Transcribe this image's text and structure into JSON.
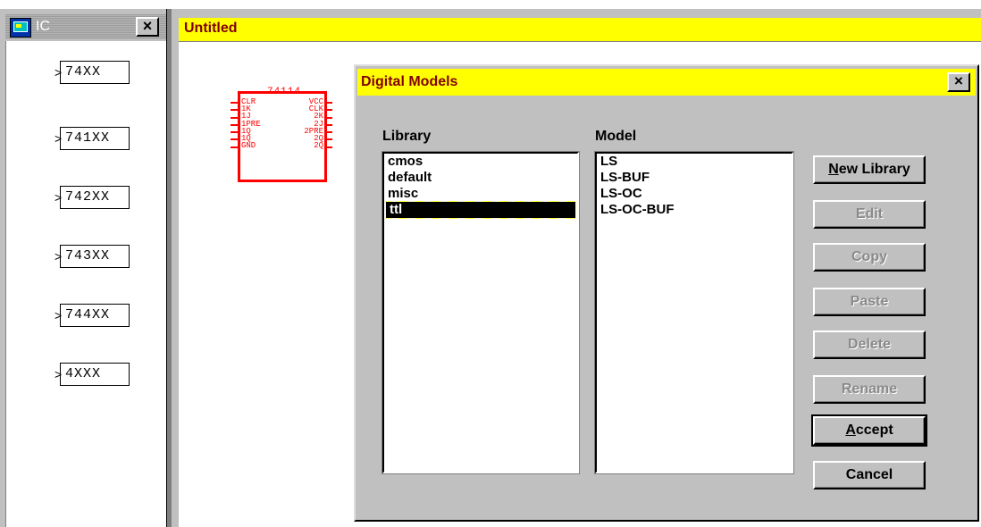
{
  "palette": {
    "title": "IC",
    "close_glyph": "×",
    "items": [
      "74XX",
      "741XX",
      "742XX",
      "743XX",
      "744XX",
      "4XXX"
    ]
  },
  "main": {
    "title": "Untitled"
  },
  "chip": {
    "name": "74114",
    "left_pins": [
      "CLR",
      "1K",
      "1J",
      "1PRE",
      "1Q",
      "1Q",
      "GND"
    ],
    "right_pins": [
      "VCC",
      "CLK",
      "2K",
      "2J",
      "2PRE",
      "2Q",
      "2Q"
    ]
  },
  "dialog": {
    "title": "Digital Models",
    "close_glyph": "×",
    "library_label": "Library",
    "model_label": "Model",
    "libraries": [
      "cmos",
      "default",
      "misc",
      "ttl"
    ],
    "selected_library": "ttl",
    "models": [
      "LS",
      "LS-BUF",
      "LS-OC",
      "LS-OC-BUF"
    ],
    "buttons": {
      "new_library": {
        "mnemonic": "N",
        "rest": "ew Library"
      },
      "edit": "Edit",
      "copy": "Copy",
      "paste": "Paste",
      "delete": "Delete",
      "rename": "Rename",
      "accept": {
        "mnemonic": "A",
        "rest": "ccept"
      },
      "cancel": "Cancel"
    }
  },
  "colors": {
    "title_bar": "#ffff00",
    "title_text": "#800000",
    "chip_red": "#ff0000",
    "face": "#c0c0c0"
  }
}
